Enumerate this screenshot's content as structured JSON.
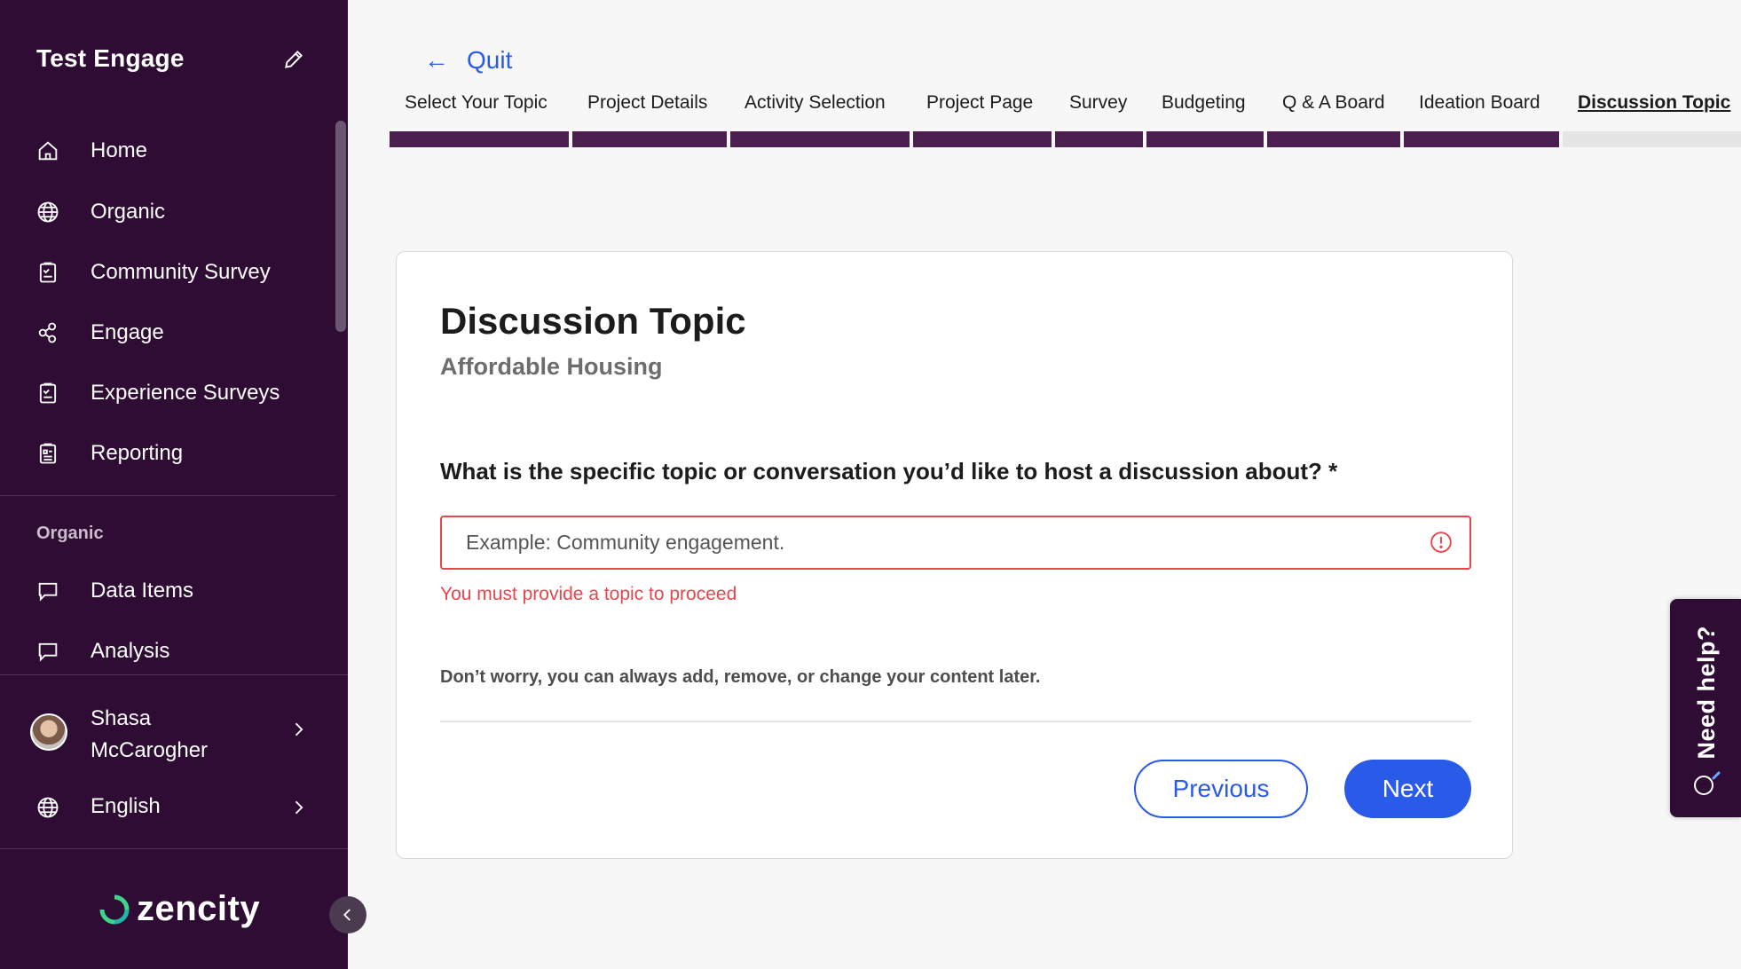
{
  "sidebar": {
    "brand": "Test Engage",
    "nav": [
      {
        "label": "Home",
        "icon": "home-icon"
      },
      {
        "label": "Organic",
        "icon": "globe-icon"
      },
      {
        "label": "Community Survey",
        "icon": "clipboard-icon"
      },
      {
        "label": "Engage",
        "icon": "engage-icon"
      },
      {
        "label": "Experience Surveys",
        "icon": "clipboard-icon"
      },
      {
        "label": "Reporting",
        "icon": "report-icon"
      }
    ],
    "section_label": "Organic",
    "section_items": [
      {
        "label": "Data Items",
        "icon": "chat-bubble-icon"
      },
      {
        "label": "Analysis",
        "icon": "chat-bubble-icon"
      }
    ],
    "user": {
      "name": "Shasa McCarogher"
    },
    "language": "English",
    "logo_text": "zencity"
  },
  "header": {
    "quit_label": "Quit",
    "steps": [
      {
        "label": "Select Your Topic",
        "status": "done"
      },
      {
        "label": "Project Details",
        "status": "done"
      },
      {
        "label": "Activity Selection",
        "status": "done"
      },
      {
        "label": "Project Page",
        "status": "done"
      },
      {
        "label": "Survey",
        "status": "done"
      },
      {
        "label": "Budgeting",
        "status": "done"
      },
      {
        "label": "Q & A Board",
        "status": "done"
      },
      {
        "label": "Ideation Board",
        "status": "done"
      },
      {
        "label": "Discussion Topic",
        "status": "current"
      }
    ]
  },
  "card": {
    "title": "Discussion Topic",
    "subtitle": "Affordable Housing",
    "question": "What is the specific topic or conversation you’d like to host a discussion about? *",
    "input": {
      "value": "",
      "placeholder": "Example: Community engagement."
    },
    "error": "You must provide a topic to proceed",
    "hint": "Don’t worry, you can always add, remove, or change your content later.",
    "previous_label": "Previous",
    "next_label": "Next"
  },
  "help_tab": {
    "label": "Need help?"
  },
  "colors": {
    "sidebar_bg": "#2e0c33",
    "accent": "#2a5ae8",
    "error": "#e5474d",
    "progress_done": "#4a1f4f"
  }
}
